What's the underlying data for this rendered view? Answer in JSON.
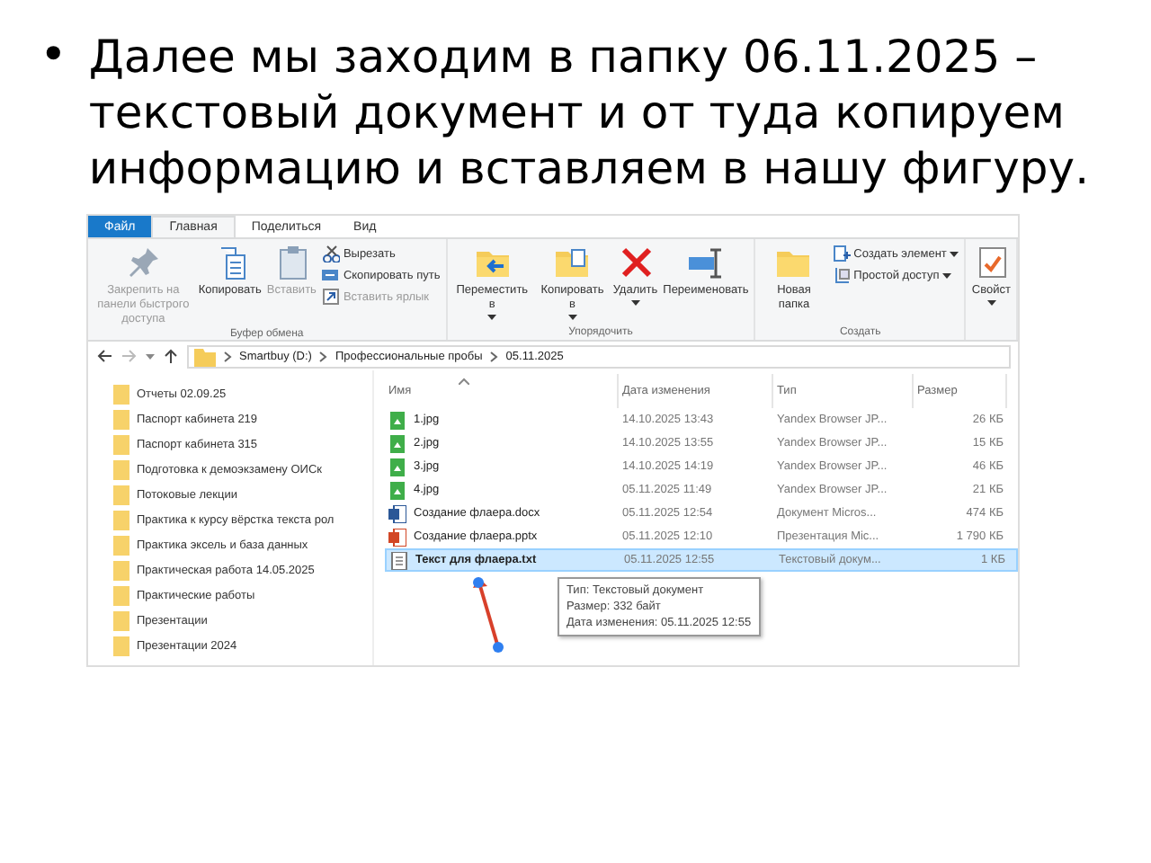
{
  "slide": {
    "bullet": "•",
    "text": "Далее мы заходим в папку 06.11.2025 – текстовый документ и от туда копируем информацию и вставляем в нашу фигуру."
  },
  "explorer": {
    "tabs": [
      {
        "label": "Файл",
        "kind": "file",
        "selected": false
      },
      {
        "label": "Главная",
        "kind": "tab",
        "selected": true
      },
      {
        "label": "Поделиться",
        "kind": "tab",
        "selected": false
      },
      {
        "label": "Вид",
        "kind": "tab",
        "selected": false
      }
    ],
    "ribbon_groups": [
      {
        "label": "Буфер обмена",
        "commands": [
          {
            "kind": "large",
            "label": "Закрепить на панели быстрого доступа",
            "disabled": true,
            "dropdown": false
          },
          {
            "kind": "large",
            "label": "Копировать",
            "disabled": false,
            "dropdown": false
          },
          {
            "kind": "large",
            "label": "Вставить",
            "disabled": true,
            "dropdown": false
          },
          {
            "kind": "small",
            "label": "Вырезать",
            "disabled": false,
            "dropdown": false
          },
          {
            "kind": "small",
            "label": "Скопировать путь",
            "disabled": false,
            "dropdown": false
          },
          {
            "kind": "small",
            "label": "Вставить ярлык",
            "disabled": true,
            "dropdown": false
          }
        ]
      },
      {
        "label": "Упорядочить",
        "commands": [
          {
            "kind": "large",
            "label": "Переместить в",
            "disabled": false,
            "dropdown": true
          },
          {
            "kind": "large",
            "label": "Копировать в",
            "disabled": false,
            "dropdown": true
          },
          {
            "kind": "large",
            "label": "Удалить",
            "disabled": false,
            "dropdown": true
          },
          {
            "kind": "large",
            "label": "Переименовать",
            "disabled": false,
            "dropdown": false
          }
        ]
      },
      {
        "label": "Создать",
        "commands": [
          {
            "kind": "large",
            "label": "Новая папка",
            "disabled": false,
            "dropdown": false
          },
          {
            "kind": "small",
            "label": "Создать элемент",
            "disabled": false,
            "dropdown": true
          },
          {
            "kind": "small",
            "label": "Простой доступ",
            "disabled": false,
            "dropdown": true
          }
        ]
      },
      {
        "commands": [
          {
            "kind": "large",
            "label": "Свойст",
            "disabled": false,
            "dropdown": true
          }
        ]
      }
    ],
    "breadcrumb": [
      "Smartbuy (D:)",
      "Профессиональные пробы",
      "05.11.2025"
    ],
    "nav_items": [
      {
        "label": "Отчеты 02.09.25"
      },
      {
        "label": "Паспорт кабинета 219"
      },
      {
        "label": "Паспорт кабинета 315"
      },
      {
        "label": "Подготовка к демоэкзамену ОИСк"
      },
      {
        "label": "Потоковые лекции"
      },
      {
        "label": "Практика к курсу вёрстка текста рол"
      },
      {
        "label": "Практика эксель и база данных"
      },
      {
        "label": "Практическая работа 14.05.2025"
      },
      {
        "label": "Практические работы"
      },
      {
        "label": "Презентации"
      },
      {
        "label": "Презентации 2024"
      }
    ],
    "columns": [
      "Имя",
      "Дата изменения",
      "Тип",
      "Размер"
    ],
    "rows": [
      {
        "kind": "image",
        "name": "1.jpg",
        "date": "14.10.2025 13:43",
        "type": "Yandex Browser JP...",
        "size": "26 КБ",
        "selected": false
      },
      {
        "kind": "image",
        "name": "2.jpg",
        "date": "14.10.2025 13:55",
        "type": "Yandex Browser JP...",
        "size": "15 КБ",
        "selected": false
      },
      {
        "kind": "image",
        "name": "3.jpg",
        "date": "14.10.2025 14:19",
        "type": "Yandex Browser JP...",
        "size": "46 КБ",
        "selected": false
      },
      {
        "kind": "image",
        "name": "4.jpg",
        "date": "05.11.2025 11:49",
        "type": "Yandex Browser JP...",
        "size": "21 КБ",
        "selected": false
      },
      {
        "kind": "word",
        "name": "Создание флаера.docx",
        "date": "05.11.2025 12:54",
        "type": "Документ Micros...",
        "size": "474 КБ",
        "selected": false
      },
      {
        "kind": "powerpoint",
        "name": "Создание флаера.pptx",
        "date": "05.11.2025 12:10",
        "type": "Презентация Mic...",
        "size": "1 790 КБ",
        "selected": false
      },
      {
        "kind": "text",
        "name": "Текст для флаера.txt",
        "date": "05.11.2025 12:55",
        "type": "Текстовый докум...",
        "size": "1 КБ",
        "selected": true
      }
    ],
    "tooltip": [
      "Тип: Текстовый документ",
      "Размер: 332 байт",
      "Дата изменения: 05.11.2025 12:55"
    ]
  }
}
